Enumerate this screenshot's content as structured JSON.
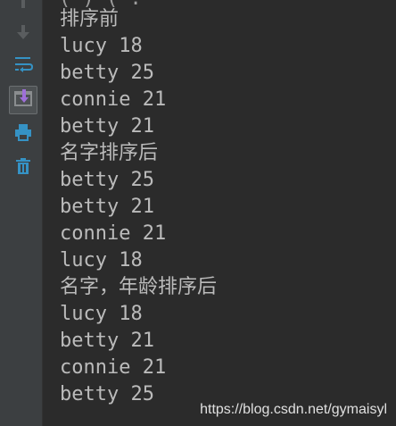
{
  "console": {
    "top_fragment": "( ) ( .",
    "lines": [
      "排序前",
      "lucy 18",
      "betty 25",
      "connie 21",
      "betty 21",
      "名字排序后",
      "betty 25",
      "betty 21",
      "connie 21",
      "lucy 18",
      "名字，年龄排序后",
      "lucy 18",
      "betty 21",
      "connie 21",
      "betty 25"
    ]
  },
  "sidebar": {
    "buttons": [
      {
        "name": "scroll-to-end-button",
        "icon": "arrow-down-icon",
        "color": "#5a5d5f"
      },
      {
        "name": "soft-wrap-button",
        "icon": "soft-wrap-icon",
        "color": "#3592c4"
      },
      {
        "name": "import-export-button",
        "icon": "import-icon",
        "color": "#9e6fd8"
      },
      {
        "name": "print-button",
        "icon": "print-icon",
        "color": "#3592c4"
      },
      {
        "name": "clear-all-button",
        "icon": "trash-icon",
        "color": "#3592c4"
      }
    ]
  },
  "watermark": {
    "text": "https://blog.csdn.net/gymaisyl"
  },
  "colors": {
    "background": "#2b2b2b",
    "sidebar": "#3c3f41",
    "text": "#bbbbbb",
    "accent": "#3592c4"
  }
}
